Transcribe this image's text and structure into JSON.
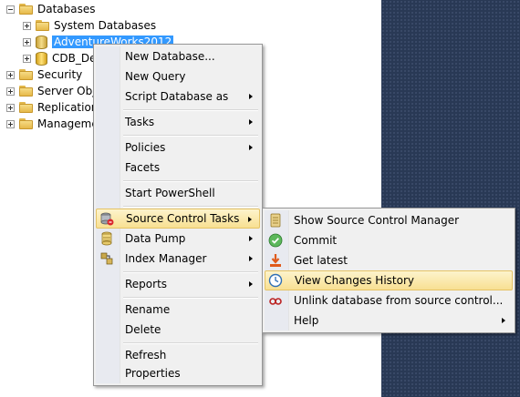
{
  "tree": {
    "databases": "Databases",
    "system_databases": "System Databases",
    "adventureworks": "AdventureWorks2012",
    "cdb": "CDB_De",
    "security": "Security",
    "server_objects": "Server Obje",
    "replication": "Replication",
    "management": "Manageme"
  },
  "context_menu": {
    "new_database": "New Database...",
    "new_query": "New Query",
    "script_database_as": "Script Database as",
    "tasks": "Tasks",
    "policies": "Policies",
    "facets": "Facets",
    "start_powershell": "Start PowerShell",
    "source_control_tasks": "Source Control Tasks",
    "data_pump": "Data Pump",
    "index_manager": "Index Manager",
    "reports": "Reports",
    "rename": "Rename",
    "delete": "Delete",
    "refresh": "Refresh",
    "properties": "Properties"
  },
  "submenu": {
    "show_manager": "Show Source Control Manager",
    "commit": "Commit",
    "get_latest": "Get latest",
    "view_history": "View Changes History",
    "unlink": "Unlink database from source control...",
    "help": "Help"
  },
  "colors": {
    "selection": "#3399ff",
    "highlight": "#f8e092",
    "panel": "#293955"
  }
}
